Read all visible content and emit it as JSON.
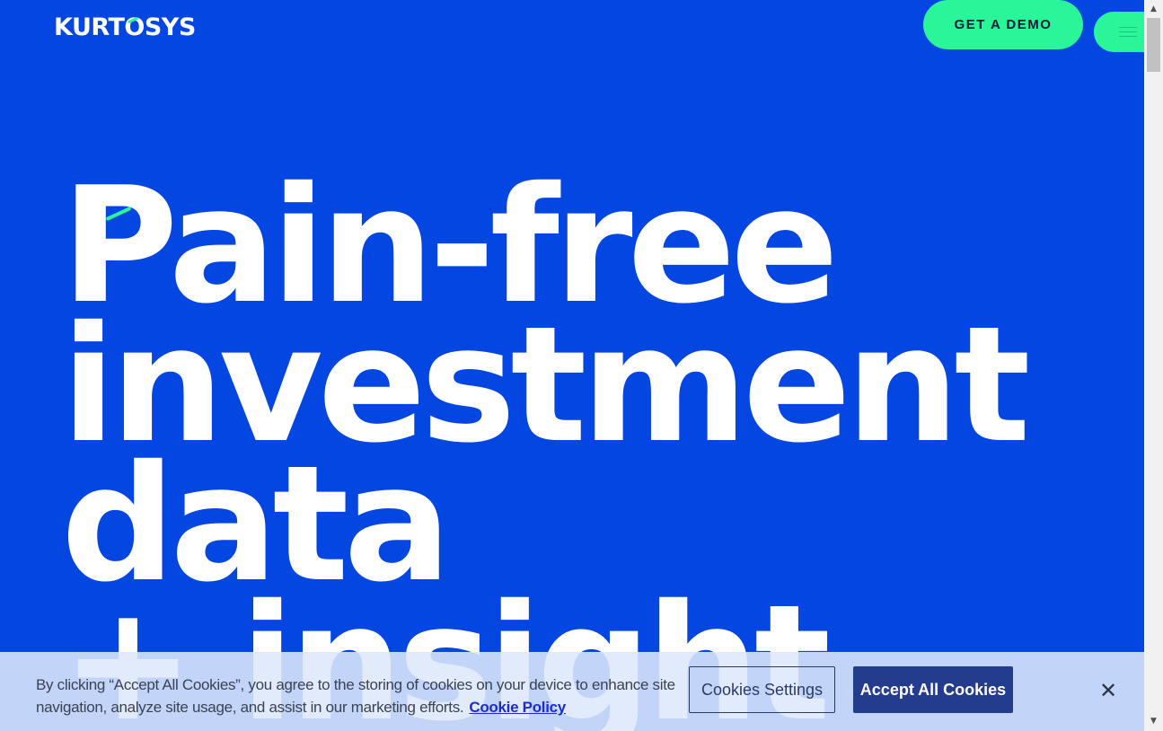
{
  "header": {
    "logo_pre": "KURT",
    "logo_o": "O",
    "logo_post": "SYS",
    "demo_label": "GET A DEMO",
    "menu_icon": "hamburger-menu-icon"
  },
  "hero": {
    "lines": [
      "Pain-free",
      "investment",
      "data",
      "+ insight"
    ]
  },
  "cookie": {
    "text": "By clicking “Accept All Cookies”, you agree to the storing of cookies on your device to enhance site navigation, analyze site usage, and assist in our marketing efforts.",
    "policy_link": "Cookie Policy",
    "settings_label": "Cookies Settings",
    "accept_label": "Accept All Cookies",
    "close_glyph": "✕"
  },
  "scrollbar": {
    "up_glyph": "▲",
    "down_glyph": "▼"
  },
  "colors": {
    "background": "#0346e2",
    "accent": "#2af598",
    "accept_button": "#233c8e"
  }
}
